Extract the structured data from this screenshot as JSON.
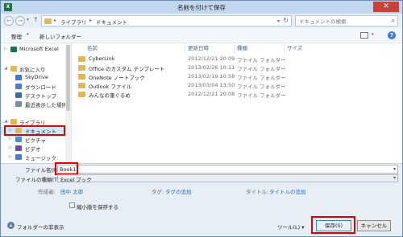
{
  "window": {
    "title": "名前を付けて保存",
    "app_icon_letter": "X",
    "close_glyph": "✕"
  },
  "address": {
    "crumbs": [
      "ライブラリ",
      "ドキュメント"
    ],
    "search_placeholder": "ドキュメントの検索"
  },
  "toolbar": {
    "organize": "整理",
    "new_folder": "新しいフォルダー"
  },
  "sidebar": {
    "items": [
      {
        "label": "Microsoft Excel",
        "icon": "excel-icon",
        "color": "#1e7145"
      },
      {
        "label": "お気に入り",
        "icon": "star-icon",
        "color": "#e2b857"
      },
      {
        "label": "SkyDrive",
        "icon": "cloud-icon",
        "color": "#3c7bd0"
      },
      {
        "label": "ダウンロード",
        "icon": "download-icon",
        "color": "#4a7bd0"
      },
      {
        "label": "デスクトップ",
        "icon": "desktop-icon",
        "color": "#3c6ea8"
      },
      {
        "label": "最近表示した場所",
        "icon": "recent-places-icon",
        "color": "#7a8ea6"
      },
      {
        "label": "ライブラリ",
        "icon": "library-icon",
        "color": "#e2b857"
      },
      {
        "label": "ドキュメント",
        "icon": "documents-icon",
        "color": "#e2b857"
      },
      {
        "label": "ピクチャ",
        "icon": "pictures-icon",
        "color": "#4a8fd0"
      },
      {
        "label": "ビデオ",
        "icon": "videos-icon",
        "color": "#6a4fa8"
      },
      {
        "label": "ミュージック",
        "icon": "music-icon",
        "color": "#4a7bd0"
      }
    ]
  },
  "filelist": {
    "columns": [
      "名前",
      "更新日時",
      "種類",
      "サイズ"
    ],
    "rows": [
      {
        "name": "CyberLink",
        "date": "2012/12/21 20:09",
        "type": "ファイル フォルダー"
      },
      {
        "name": "Office のカスタム テンプレート",
        "date": "2013/02/26 10:11",
        "type": "ファイル フォルダー"
      },
      {
        "name": "OneNote ノートブック",
        "date": "2013/02/19 10:58",
        "type": "ファイル フォルダー"
      },
      {
        "name": "Outlook ファイル",
        "date": "2013/03/04 13:50",
        "type": "ファイル フォルダー"
      },
      {
        "name": "みんなの筆ぐるめ",
        "date": "2012/12/21 20:08",
        "type": "ファイル フォルダー"
      }
    ]
  },
  "form": {
    "filename_label": "ファイル名(N):",
    "filename_value": "Book1",
    "filetype_label": "ファイルの種類(T):",
    "filetype_value": "Excel ブック",
    "author_label": "作成者:",
    "author_value": "田中 太郎",
    "tags_label": "タグ:",
    "tags_value": "タグの追加",
    "title_label": "タイトル:",
    "title_value": "タイトルの追加",
    "thumbnail_label": "縮小版を保存する"
  },
  "footer": {
    "hide_folders": "フォルダーの非表示",
    "tools": "ツール(L)",
    "save": "保存(S)",
    "cancel": "キャンセル"
  },
  "colors": {
    "highlight": "#e00000",
    "selected_bg": "#cde8ff",
    "link": "#2b6cbf"
  }
}
